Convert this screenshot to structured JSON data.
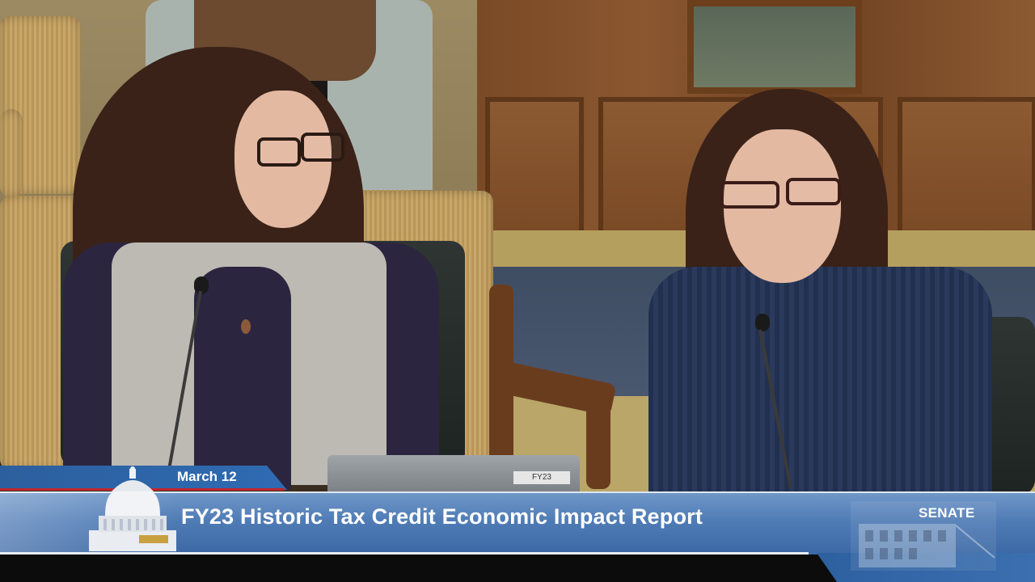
{
  "lower_third": {
    "date": "March 12",
    "title": "FY23 Historic Tax Credit Economic Impact Report",
    "network": "SENATE"
  },
  "laptop_sticker": "FY23",
  "colors": {
    "banner_blue": "#4f7bb5",
    "banner_dark": "#2c5f9e",
    "accent_red": "#c0272d"
  }
}
